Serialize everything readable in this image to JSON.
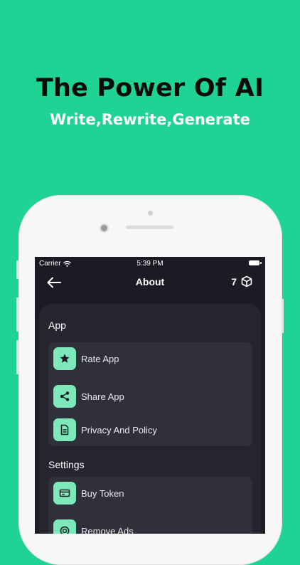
{
  "promo": {
    "headline": "The Power Of AI",
    "subheadline": "Write,Rewrite,Generate"
  },
  "status_bar": {
    "carrier": "Carrier",
    "time": "5:39 PM"
  },
  "nav": {
    "title": "About",
    "token_count": "7"
  },
  "sections": [
    {
      "title": "App",
      "items": [
        {
          "label": "Rate App",
          "icon": "star-icon"
        },
        {
          "label": "Share App",
          "icon": "share-icon"
        },
        {
          "label": "Privacy And Policy",
          "icon": "document-icon"
        }
      ]
    },
    {
      "title": "Settings",
      "items": [
        {
          "label": "Buy Token",
          "icon": "card-icon"
        },
        {
          "label": "Remove Ads",
          "icon": "no-ads-icon"
        }
      ]
    }
  ],
  "colors": {
    "background": "#1fd394",
    "icon_tile": "#7de8b9",
    "screen": "#1b1c23",
    "card": "#24252e",
    "group": "#2f303a"
  }
}
